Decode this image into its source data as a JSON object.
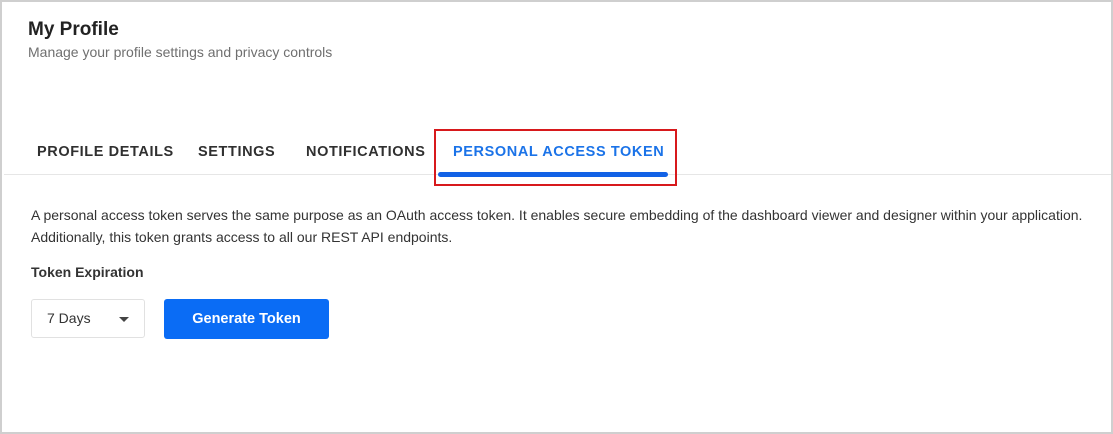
{
  "header": {
    "title": "My Profile",
    "subtitle": "Manage your profile settings and privacy controls"
  },
  "tabs": [
    {
      "label": "PROFILE DETAILS",
      "active": false
    },
    {
      "label": "SETTINGS",
      "active": false
    },
    {
      "label": "NOTIFICATIONS",
      "active": false
    },
    {
      "label": "PERSONAL ACCESS TOKEN",
      "active": true
    }
  ],
  "token": {
    "description": "A personal access token serves the same purpose as an OAuth access token. It enables secure embedding of the dashboard viewer and designer within your application. Additionally, this token grants access to all our REST API endpoints.",
    "expiration_label": "Token Expiration",
    "expiration_value": "7 Days",
    "generate_label": "Generate Token"
  },
  "colors": {
    "accent": "#0a6cf5",
    "active_tab": "#1b73e8",
    "highlight": "#d7191c"
  }
}
